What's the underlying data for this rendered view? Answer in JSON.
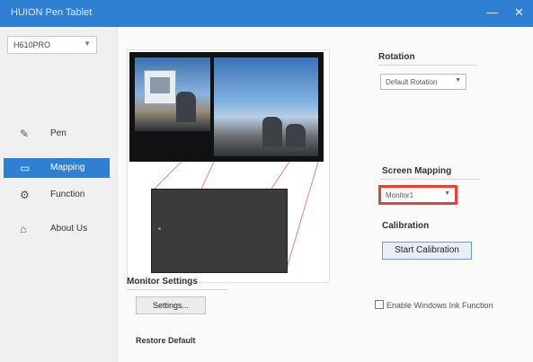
{
  "window": {
    "title": "HUION Pen Tablet",
    "min_label": "—",
    "close_label": "✕"
  },
  "sidebar": {
    "device": "H610PRO",
    "items": [
      {
        "label": "Pen",
        "icon": "pen-icon",
        "active": false
      },
      {
        "label": "Mapping",
        "icon": "monitor-icon",
        "active": true
      },
      {
        "label": "Function",
        "icon": "gear-icon",
        "active": false
      },
      {
        "label": "About Us",
        "icon": "home-icon",
        "active": false
      }
    ]
  },
  "rotation": {
    "title": "Rotation",
    "value": "Default Rotation"
  },
  "screen_mapping": {
    "title": "Screen Mapping",
    "value": "Monitor1"
  },
  "calibration": {
    "title": "Calibration",
    "button": "Start Calibration"
  },
  "monitor_settings": {
    "title": "Monitor Settings",
    "button": "Settings..."
  },
  "options": {
    "windows_ink": "Enable Windows Ink Function",
    "windows_ink_checked": false
  },
  "footer": {
    "restore": "Restore Default"
  },
  "colors": {
    "accent": "#2f80d3",
    "highlight": "#e0443a"
  }
}
